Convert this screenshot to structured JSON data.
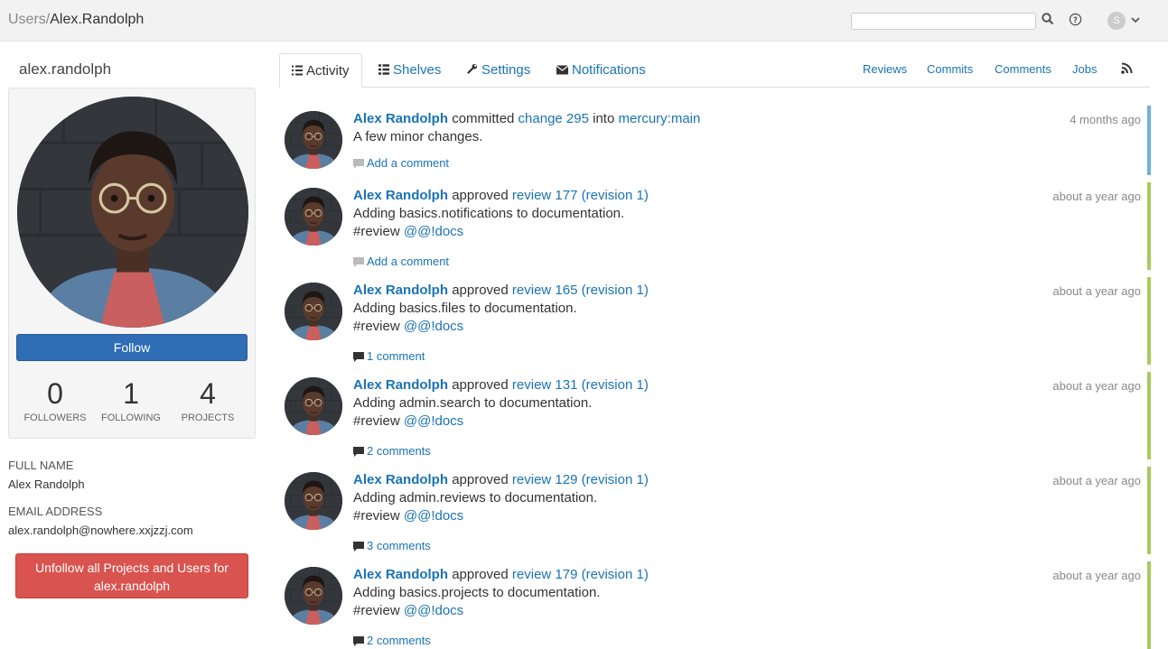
{
  "colors": {
    "accent": "#1a73b5",
    "follow": "#2f6db5",
    "danger": "#d9534f",
    "bar_change": "#6fb2dd",
    "bar_review": "#a6cc5c"
  },
  "breadcrumb": {
    "root": "Users/",
    "current": "Alex.Randolph"
  },
  "header": {
    "search_placeholder": "",
    "user_initial": "S"
  },
  "profile": {
    "username": "alex.randolph",
    "follow_label": "Follow",
    "stats": [
      {
        "num": "0",
        "label": "FOLLOWERS"
      },
      {
        "num": "1",
        "label": "FOLLOWING"
      },
      {
        "num": "4",
        "label": "PROJECTS"
      }
    ],
    "full_name_label": "FULL NAME",
    "full_name": "Alex Randolph",
    "email_label": "EMAIL ADDRESS",
    "email": "alex.randolph@nowhere.xxjzzj.com",
    "unfollow_line1": "Unfollow all Projects and Users for",
    "unfollow_line2": "alex.randolph"
  },
  "tabs": [
    {
      "label": "Activity",
      "icon": "list-icon"
    },
    {
      "label": "Shelves",
      "icon": "table-icon"
    },
    {
      "label": "Settings",
      "icon": "wrench-icon"
    },
    {
      "label": "Notifications",
      "icon": "envelope-icon"
    }
  ],
  "filters": [
    "Reviews",
    "Commits",
    "Comments",
    "Jobs"
  ],
  "feed": [
    {
      "who": "Alex Randolph",
      "verb": "committed",
      "target": "change 295",
      "mid": "into",
      "target2": "mercury:main",
      "desc": "A few minor changes.",
      "tag": "",
      "tag_link": "",
      "comments": "Add a comment",
      "time": "4 months ago",
      "type": "change"
    },
    {
      "who": "Alex Randolph",
      "verb": "approved",
      "target": "review 177 (revision 1)",
      "mid": "",
      "target2": "",
      "desc": "Adding basics.notifications to documentation.",
      "tag": "#review",
      "tag_link": "@@!docs",
      "comments": "Add a comment",
      "time": "about a year ago",
      "type": "review"
    },
    {
      "who": "Alex Randolph",
      "verb": "approved",
      "target": "review 165 (revision 1)",
      "mid": "",
      "target2": "",
      "desc": "Adding basics.files to documentation.",
      "tag": "#review",
      "tag_link": "@@!docs",
      "comments": "1 comment",
      "time": "about a year ago",
      "type": "review"
    },
    {
      "who": "Alex Randolph",
      "verb": "approved",
      "target": "review 131 (revision 1)",
      "mid": "",
      "target2": "",
      "desc": "Adding admin.search to documentation.",
      "tag": "#review",
      "tag_link": "@@!docs",
      "comments": "2 comments",
      "time": "about a year ago",
      "type": "review"
    },
    {
      "who": "Alex Randolph",
      "verb": "approved",
      "target": "review 129 (revision 1)",
      "mid": "",
      "target2": "",
      "desc": "Adding admin.reviews to documentation.",
      "tag": "#review",
      "tag_link": "@@!docs",
      "comments": "3 comments",
      "time": "about a year ago",
      "type": "review"
    },
    {
      "who": "Alex Randolph",
      "verb": "approved",
      "target": "review 179 (revision 1)",
      "mid": "",
      "target2": "",
      "desc": "Adding basics.projects to documentation.",
      "tag": "#review",
      "tag_link": "@@!docs",
      "comments": "2 comments",
      "time": "about a year ago",
      "type": "review"
    }
  ]
}
